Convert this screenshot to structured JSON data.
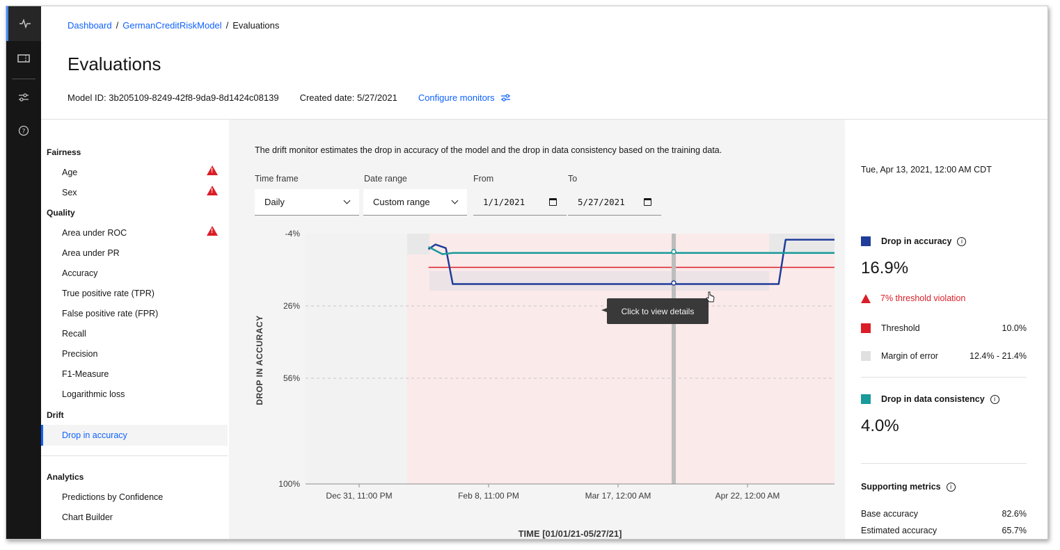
{
  "rail": {
    "icons": [
      "activity-icon",
      "ticket-icon",
      "settings-adjust-icon",
      "help-icon"
    ]
  },
  "breadcrumb": {
    "items": [
      "Dashboard",
      "GermanCreditRiskModel",
      "Evaluations"
    ]
  },
  "page": {
    "title": "Evaluations",
    "model_id": "Model ID: 3b205109-8249-42f8-9da9-8d1424c08139",
    "created_date": "Created date: 5/27/2021",
    "configure_label": "Configure monitors"
  },
  "sidenav": {
    "groups": {
      "fairness": "Fairness",
      "quality": "Quality",
      "drift": "Drift",
      "analytics": "Analytics"
    },
    "fairness_items": [
      "Age",
      "Sex"
    ],
    "quality_items": [
      "Area under ROC",
      "Area under PR",
      "Accuracy",
      "True positive rate (TPR)",
      "False positive rate (FPR)",
      "Recall",
      "Precision",
      "F1-Measure",
      "Logarithmic loss"
    ],
    "drift_items": [
      "Drop in accuracy"
    ],
    "analytics_items": [
      "Predictions by Confidence",
      "Chart Builder"
    ]
  },
  "main": {
    "description": "The drift monitor estimates the drop in accuracy of the model and the drop in data consistency based on the training data.",
    "time_frame_label": "Time frame",
    "time_frame_value": "Daily",
    "date_range_label": "Date range",
    "date_range_value": "Custom range",
    "from_label": "From",
    "from_value": "1/1/2021",
    "to_label": "To",
    "to_value": "5/27/2021",
    "tooltip": "Click to view details"
  },
  "chart_data": {
    "type": "line",
    "ylabel": "DROP IN ACCURACY",
    "xlabel": "TIME [01/01/21-05/27/21]",
    "y_ticks": [
      "-4%",
      "26%",
      "56%",
      "100%"
    ],
    "x_ticks": [
      "Dec 31, 11:00 PM",
      "Feb 8, 11:00 PM",
      "Mar 17, 12:00 AM",
      "Apr 22, 12:00 AM"
    ],
    "ylim": [
      -4,
      100
    ],
    "y_inverted": true,
    "threshold": 10.0,
    "series": [
      {
        "name": "Drop in accuracy",
        "color": "#1f3d99",
        "points": [
          [
            "Jan 20",
            2.5
          ],
          [
            "Jan 22",
            0.5
          ],
          [
            "Jan 25",
            2.0
          ],
          [
            "Jan 27",
            16.9
          ],
          [
            "May 1",
            16.9
          ],
          [
            "May 3",
            -1.5
          ],
          [
            "May 27",
            -1.5
          ]
        ]
      },
      {
        "name": "Drop in data consistency",
        "color": "#1a9a9a",
        "points": [
          [
            "Jan 20",
            1.5
          ],
          [
            "Jan 24",
            4.5
          ],
          [
            "Jan 27",
            4.0
          ],
          [
            "May 27",
            4.0
          ]
        ]
      }
    ]
  },
  "right": {
    "timestamp": "Tue, Apr 13, 2021, 12:00 AM CDT",
    "accuracy_label": "Drop in accuracy",
    "accuracy_value": "16.9%",
    "violation": "7% threshold violation",
    "threshold_label": "Threshold",
    "threshold_value": "10.0%",
    "margin_label": "Margin of error",
    "margin_value": "12.4% - 21.4%",
    "consistency_label": "Drop in data consistency",
    "consistency_value": "4.0%",
    "supporting_label": "Supporting metrics",
    "base_label": "Base accuracy",
    "base_value": "82.6%",
    "estimated_label": "Estimated accuracy",
    "estimated_value": "65.7%",
    "colors": {
      "accuracy": "#1f3d99",
      "threshold": "#da1e28",
      "margin": "#e0e0e0",
      "consistency": "#1a9a9a"
    }
  }
}
